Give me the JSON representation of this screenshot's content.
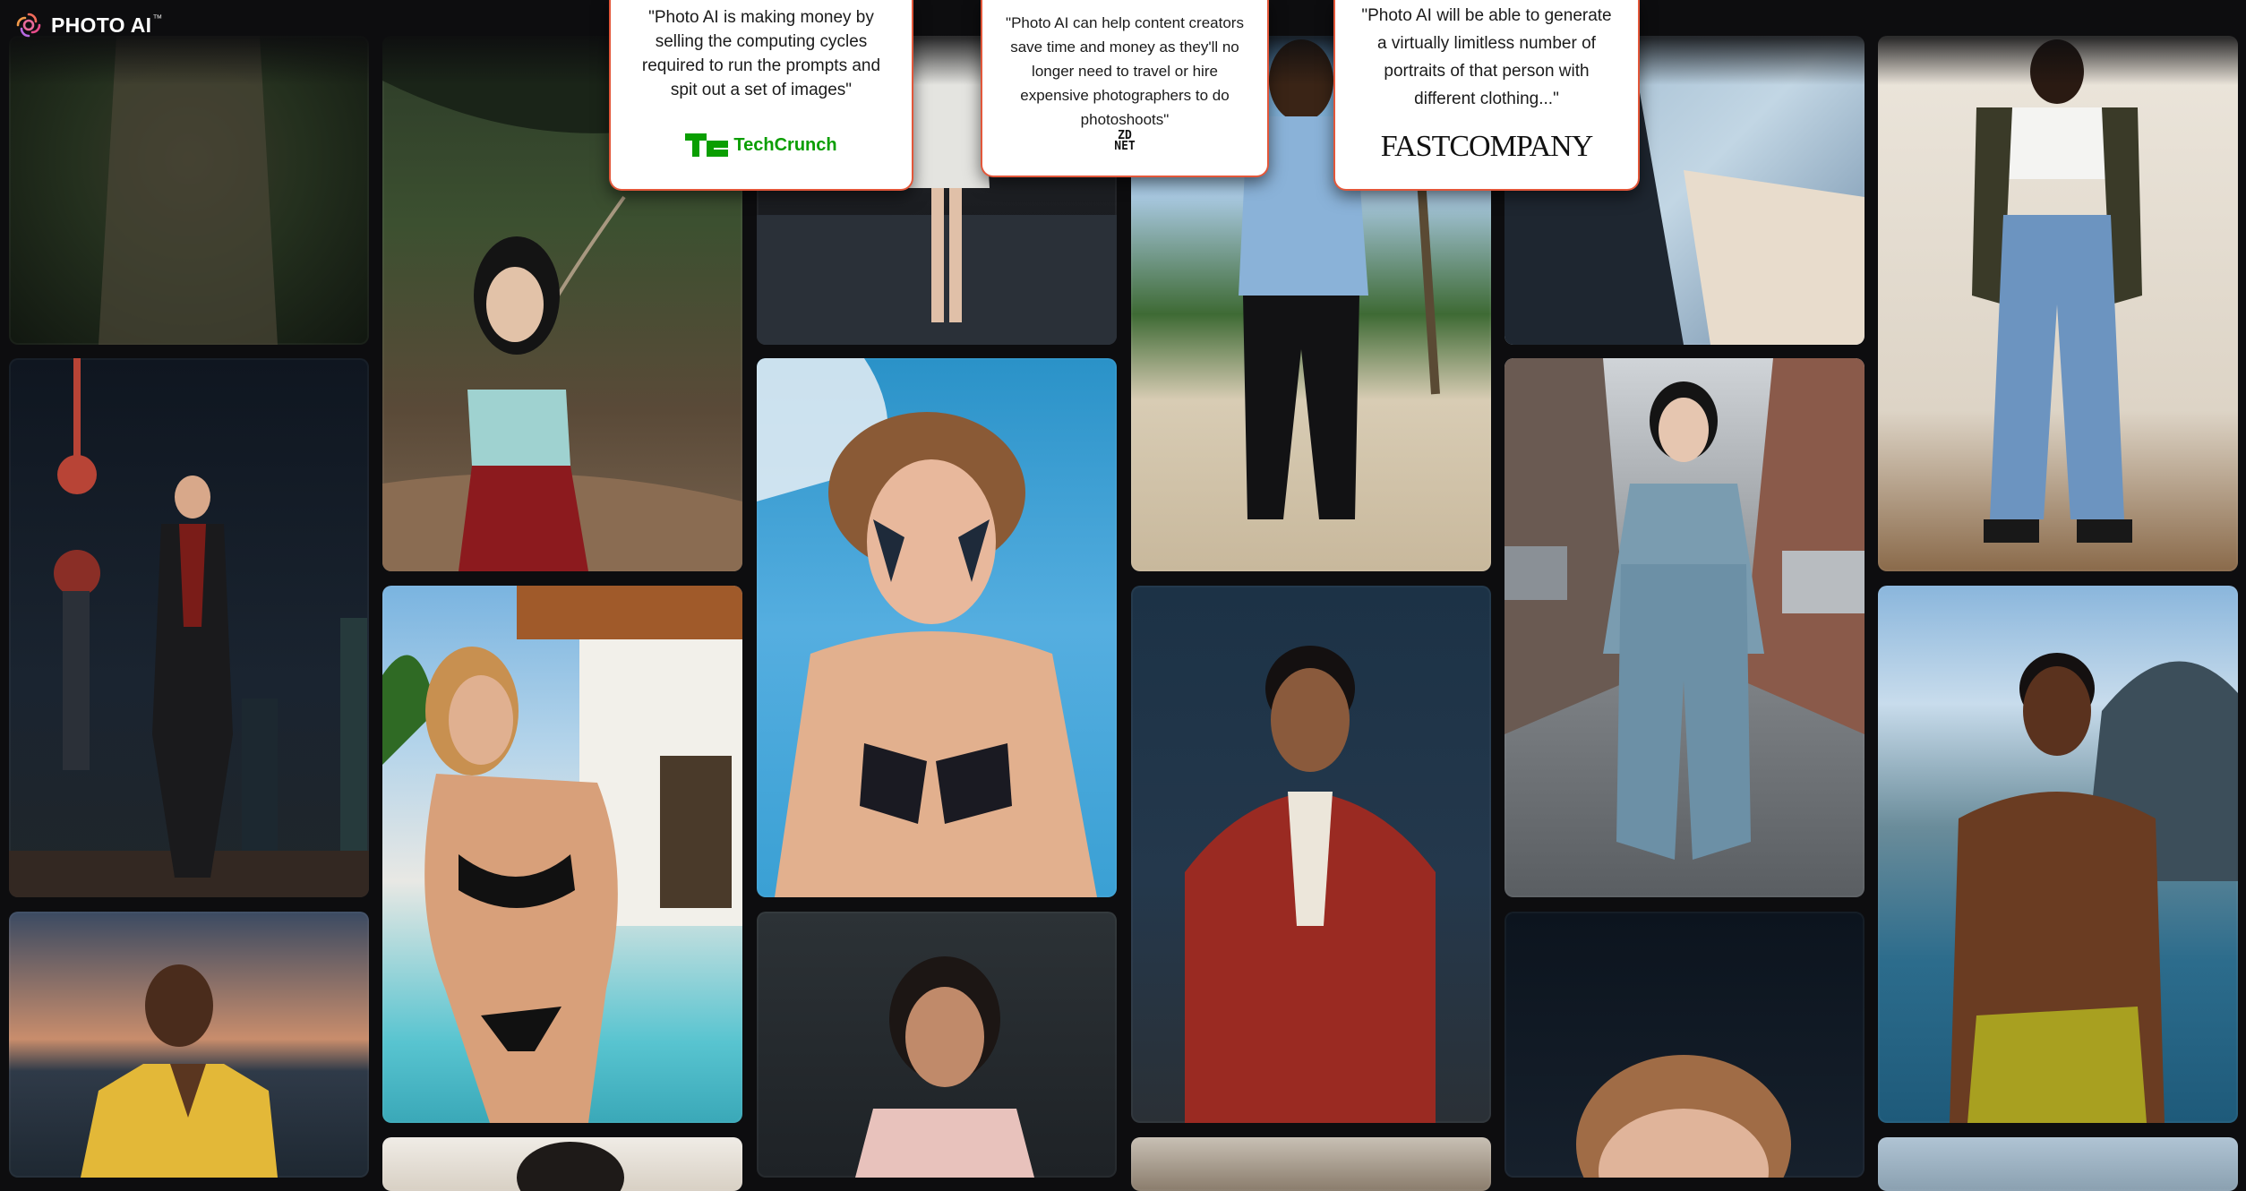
{
  "brand": {
    "name": "PHOTO AI",
    "trademark": "™",
    "accent_color": "#e3573a"
  },
  "testimonials": [
    {
      "quote": "\"Photo AI is making money by selling the computing cycles required to run the prompts and spit out a set of images\"",
      "publication": "TechCrunch",
      "logo_icon": "techcrunch-logo"
    },
    {
      "quote": "\"Photo AI can help content creators save time and money as they'll no longer need to travel or hire expensive photographers to do photoshoots\"",
      "publication": "ZDNET",
      "logo_icon": "zdnet-logo"
    },
    {
      "quote": "\"Photo AI will be able to generate a virtually limitless number of portraits of that person with different clothing...\"",
      "publication": "FASTCOMPANY",
      "logo_icon": "fastcompany-logo"
    }
  ],
  "gallery": {
    "photos": [
      {
        "subject": "woman-in-dress-forest"
      },
      {
        "subject": "man-in-suit-city-night"
      },
      {
        "subject": "man-yellow-shirt-sunset"
      },
      {
        "subject": "woman-mountain-valley"
      },
      {
        "subject": "woman-bikini-pool"
      },
      {
        "subject": "photo-partial"
      },
      {
        "subject": "woman-white-coat-stairs"
      },
      {
        "subject": "man-face-paint-sky"
      },
      {
        "subject": "woman-portrait-office"
      },
      {
        "subject": "man-beach-blue-shirt"
      },
      {
        "subject": "man-red-suit"
      },
      {
        "subject": "photo-partial"
      },
      {
        "subject": "man-blue-shirt-closeup"
      },
      {
        "subject": "woman-denim-street"
      },
      {
        "subject": "man-portrait-dark"
      },
      {
        "subject": "man-denim-studio"
      },
      {
        "subject": "man-shirtless-beach"
      },
      {
        "subject": "photo-partial"
      }
    ]
  }
}
